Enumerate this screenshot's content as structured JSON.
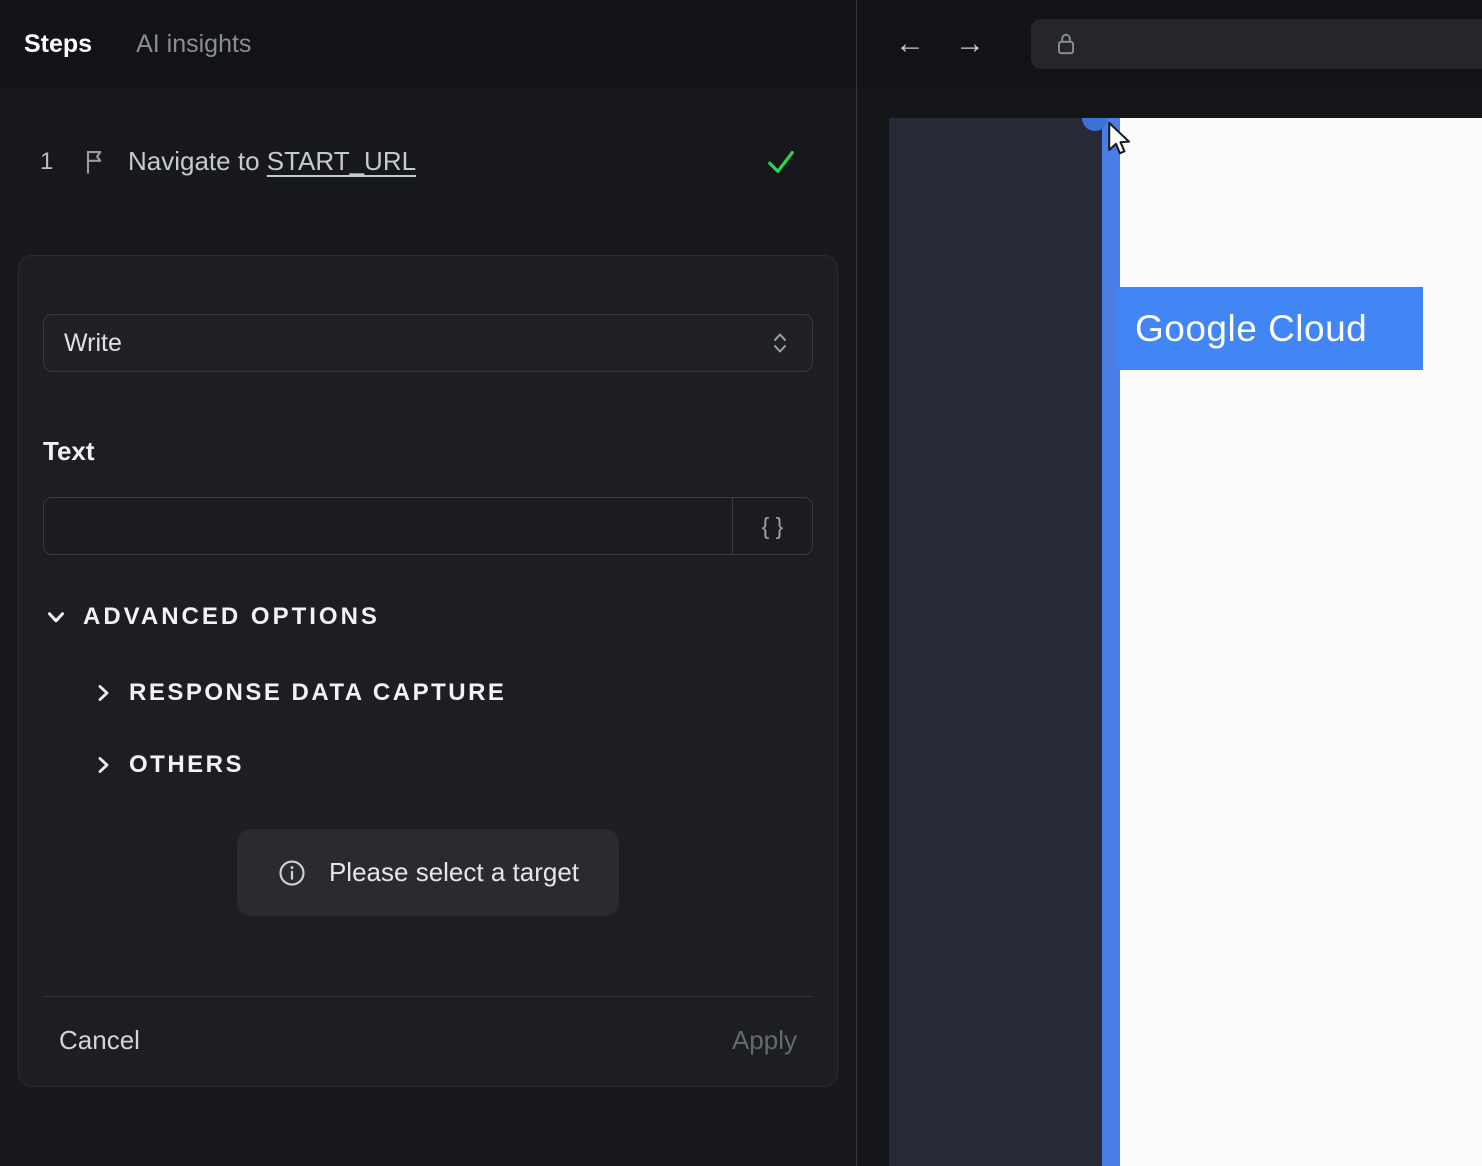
{
  "left": {
    "tabs": [
      {
        "label": "Steps"
      },
      {
        "label": "AI insights"
      }
    ],
    "step": {
      "number": "1",
      "label": "Navigate to",
      "link": "START_URL"
    },
    "editor": {
      "action_value": "Write",
      "text_label": "Text",
      "text_value": "",
      "braces_label": "{ }",
      "advanced_label": "ADVANCED OPTIONS",
      "sections": [
        {
          "label": "RESPONSE DATA CAPTURE"
        },
        {
          "label": "OTHERS"
        }
      ],
      "toast_text": "Please select a target",
      "cancel_label": "Cancel",
      "apply_label": "Apply"
    }
  },
  "browser": {
    "back_glyph": "←",
    "forward_glyph": "→",
    "url_value": "",
    "page": {
      "highlight_label": "Google Cloud"
    }
  },
  "colors": {
    "accent_blue": "#4285f4",
    "stripe_blue": "#4a7ee4",
    "success_green": "#2fd24f"
  }
}
